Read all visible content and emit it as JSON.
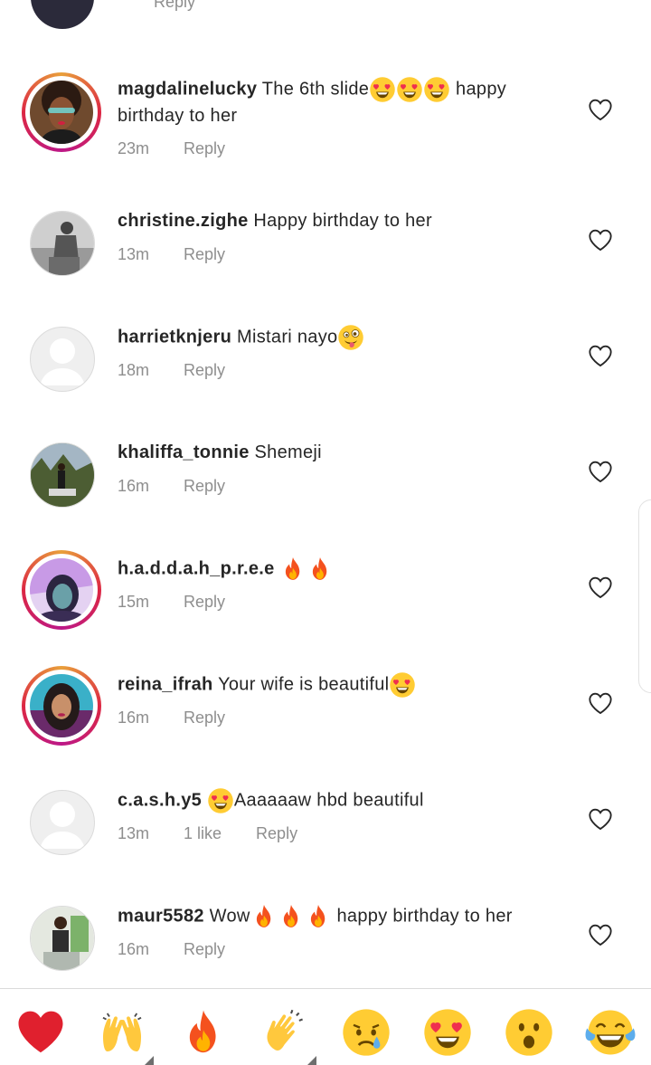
{
  "partial_comment": {
    "time": "",
    "reply": "Reply"
  },
  "comments": [
    {
      "username": "magdalinelucky",
      "pre_text": "The 6th slide",
      "post_text": " happy birthday to her",
      "time": "23m",
      "likes": "",
      "reply": "Reply"
    },
    {
      "username": "christine.zighe",
      "pre_text": "Happy birthday to her",
      "post_text": "",
      "time": "13m",
      "likes": "",
      "reply": "Reply"
    },
    {
      "username": "harrietknjeru",
      "pre_text": "Mistari nayo",
      "post_text": "",
      "time": "18m",
      "likes": "",
      "reply": "Reply"
    },
    {
      "username": "khaliffa_tonnie",
      "pre_text": "Shemeji",
      "post_text": "",
      "time": "16m",
      "likes": "",
      "reply": "Reply"
    },
    {
      "username": "h.a.d.d.a.h_p.r.e.e",
      "pre_text": "",
      "post_text": "",
      "time": "15m",
      "likes": "",
      "reply": "Reply"
    },
    {
      "username": "reina_ifrah",
      "pre_text": "Your wife is beautiful",
      "post_text": "",
      "time": "16m",
      "likes": "",
      "reply": "Reply"
    },
    {
      "username": "c.a.s.h.y5",
      "pre_text": "",
      "post_text": "Aaaaaaw hbd beautiful",
      "time": "13m",
      "likes": "1 like",
      "reply": "Reply"
    },
    {
      "username": "maur5582",
      "pre_text": "Wow",
      "post_text": " happy birthday to her",
      "time": "16m",
      "likes": "",
      "reply": "Reply"
    }
  ],
  "emoji_bar": [
    "red-heart",
    "raising-hands",
    "fire",
    "clapping-hands",
    "crying-face",
    "heart-eyes-face",
    "astonished-face",
    "tears-of-joy-face"
  ],
  "colors": {
    "text": "#262626",
    "meta": "#8e8e8e",
    "story_ring": "#dc2743",
    "heart": "#e0202e"
  }
}
